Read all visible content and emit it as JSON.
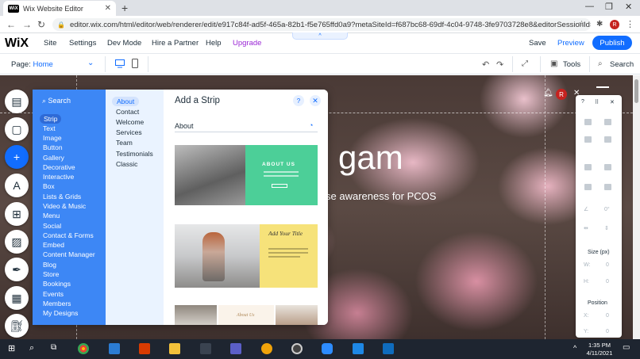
{
  "browser": {
    "tab_title": "Wix Website Editor",
    "favicon_text": "WiX",
    "url": "editor.wix.com/html/editor/web/renderer/edit/e917c84f-ad5f-465a-82b1-f5e765ffd0a9?metaSiteId=f687bc68-69df-4c04-9748-3fe9703728e8&editorSessionId=622bf8a4-45...",
    "profile_initial": "R"
  },
  "wix_topbar": {
    "logo": "WiX",
    "menu": [
      "Site",
      "Settings",
      "Dev Mode",
      "Hire a Partner",
      "Help",
      "Upgrade"
    ],
    "save_label": "Save",
    "preview_label": "Preview",
    "publish_label": "Publish"
  },
  "toolbar2": {
    "page_label": "Page:",
    "page_value": "Home",
    "tools_label": "Tools",
    "search_label": "Search"
  },
  "canvas": {
    "hero_word": "gam",
    "hero_sub": "se awareness for PCOS",
    "site_avatar": "R"
  },
  "add_panel": {
    "search_label": "Search",
    "categories": [
      "Strip",
      "Text",
      "Image",
      "Button",
      "Gallery",
      "Decorative",
      "Interactive",
      "Box",
      "Lists & Grids",
      "Video & Music",
      "Menu",
      "Social",
      "Contact & Forms",
      "Embed",
      "Content Manager",
      "Blog",
      "Store",
      "Bookings",
      "Events",
      "Members",
      "My Designs"
    ],
    "selected_category": "Strip",
    "subcategories": [
      "About",
      "Contact",
      "Welcome",
      "Services",
      "Team",
      "Testimonials",
      "Classic"
    ],
    "selected_subcategory": "About",
    "title": "Add a Strip",
    "section_heading": "About",
    "thumb1_text": "ABOUT US",
    "thumb2_text": "Add Your Title",
    "thumb3_text": "About Us"
  },
  "inspector": {
    "size_label": "Size (px)",
    "w_label": "W:",
    "w_value": "0",
    "h_label": "H:",
    "h_value": "0",
    "position_label": "Position",
    "x_label": "X:",
    "x_value": "0",
    "y_label": "Y:",
    "y_value": "0",
    "angle_value": "0°"
  },
  "taskbar": {
    "time": "1:35 PM",
    "date": "4/11/2021"
  },
  "colors": {
    "wix_blue": "#116dff",
    "category_blue": "#3d87f5",
    "upgrade_purple": "#9a27d5",
    "thumb_green": "#4ccf98",
    "thumb_yellow": "#f6e27a"
  }
}
